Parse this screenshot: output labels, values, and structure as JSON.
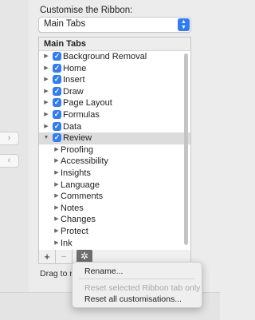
{
  "customise": {
    "label": "Customise the Ribbon:",
    "dropdown_value": "Main Tabs"
  },
  "tree": {
    "header": "Main Tabs",
    "items": [
      {
        "label": "Background Removal",
        "checked": true,
        "expanded": false
      },
      {
        "label": "Home",
        "checked": true,
        "expanded": false
      },
      {
        "label": "Insert",
        "checked": true,
        "expanded": false
      },
      {
        "label": "Draw",
        "checked": true,
        "expanded": false
      },
      {
        "label": "Page Layout",
        "checked": true,
        "expanded": false
      },
      {
        "label": "Formulas",
        "checked": true,
        "expanded": false
      },
      {
        "label": "Data",
        "checked": true,
        "expanded": false
      },
      {
        "label": "Review",
        "checked": true,
        "expanded": true,
        "selected": true
      }
    ],
    "review_groups": [
      "Proofing",
      "Accessibility",
      "Insights",
      "Language",
      "Comments",
      "Notes",
      "Changes",
      "Protect",
      "Ink"
    ]
  },
  "buttons": {
    "add": "+",
    "remove": "−",
    "gear": "✲"
  },
  "drag_text": "Drag to re",
  "context_menu": {
    "rename": "Rename...",
    "reset_selected": "Reset selected Ribbon tab only",
    "reset_all": "Reset all customisations..."
  },
  "colors": {
    "accent": "#2f7cf6"
  }
}
